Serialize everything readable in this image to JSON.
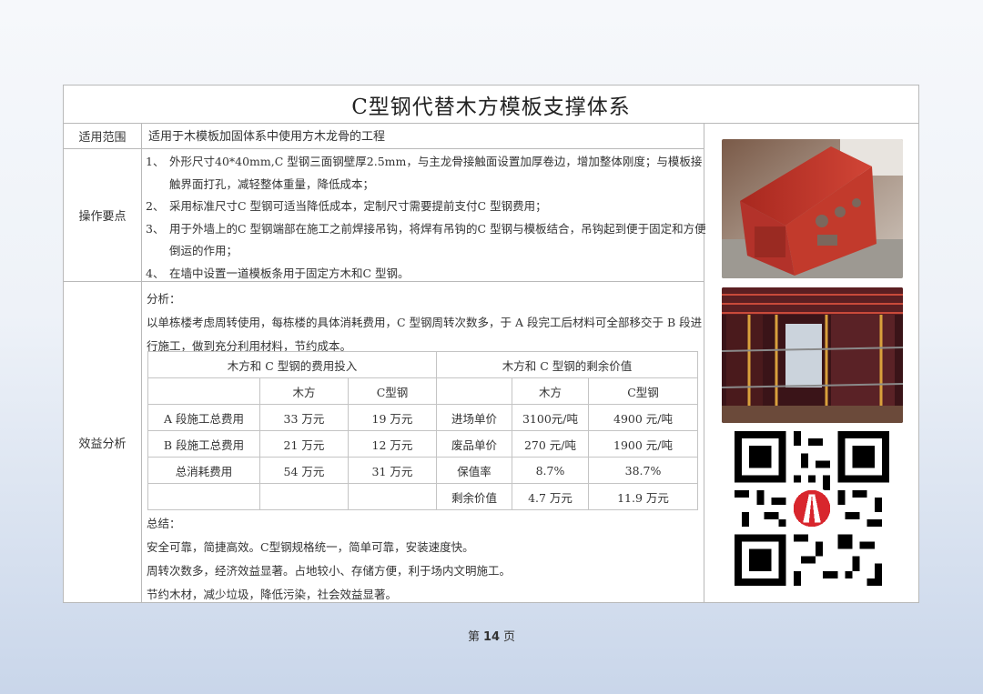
{
  "document": {
    "title": "C型钢代替木方模板支撑体系",
    "rows": {
      "scope": {
        "label": "适用范围",
        "text": "适用于木模板加固体系中使用方木龙骨的工程"
      },
      "operation": {
        "label": "操作要点",
        "items": [
          {
            "num": "1、",
            "text": "外形尺寸40*40mm,C 型钢三面钢壁厚2.5mm，与主龙骨接触面设置加厚卷边，增加整体刚度；与模板接触界面打孔，减轻整体重量，降低成本；"
          },
          {
            "num": "2、",
            "text": "采用标准尺寸C 型钢可适当降低成本，定制尺寸需要提前支付C 型钢费用；"
          },
          {
            "num": "3、",
            "text": "用于外墙上的C 型钢端部在施工之前焊接吊钩，将焊有吊钩的C 型钢与模板结合，吊钩起到便于固定和方便倒运的作用；"
          },
          {
            "num": "4、",
            "text": "在墙中设置一道模板条用于固定方木和C 型钢。"
          }
        ]
      },
      "benefit": {
        "label": "效益分析",
        "analysis_heading": "分析：",
        "analysis_text": "以单栋楼考虑周转使用，每栋楼的具体消耗费用，C 型钢周转次数多，于 A 段完工后材料可全部移交于 B 段进行施工，做到充分利用材料，节约成本。",
        "table": {
          "group_headers": [
            "木方和 C 型钢的费用投入",
            "木方和 C 型钢的剩余价值"
          ],
          "sub_headers": [
            "",
            "木方",
            "C型钢",
            "",
            "木方",
            "C型钢"
          ],
          "rows": [
            [
              "A 段施工总费用",
              "33 万元",
              "19 万元",
              "进场单价",
              "3100元/吨",
              "4900 元/吨"
            ],
            [
              "B 段施工总费用",
              "21 万元",
              "12 万元",
              "废品单价",
              "270 元/吨",
              "1900 元/吨"
            ],
            [
              "总消耗费用",
              "54 万元",
              "31 万元",
              "保值率",
              "8.7%",
              "38.7%"
            ],
            [
              "",
              "",
              "",
              "剩余价值",
              "4.7 万元",
              "11.9 万元"
            ]
          ]
        },
        "summary_heading": "总结：",
        "summary_lines": [
          "安全可靠，简捷高效。C型钢规格统一，简单可靠，安装速度快。",
          "周转次数多，经济效益显著。占地较小、存储方便，利于场内文明施工。",
          "节约木材，减少垃圾，降低污染，社会效益显著。"
        ]
      }
    }
  },
  "footer": {
    "prefix": "第",
    "page": "14",
    "suffix": "页"
  },
  "colors": {
    "steel_red": "#c23a2c",
    "logo_red": "#d8262d",
    "border": "#b9b9b9"
  },
  "images": [
    "c-steel-profile-photo",
    "formwork-installation-photo",
    "qr-code-with-logo"
  ]
}
